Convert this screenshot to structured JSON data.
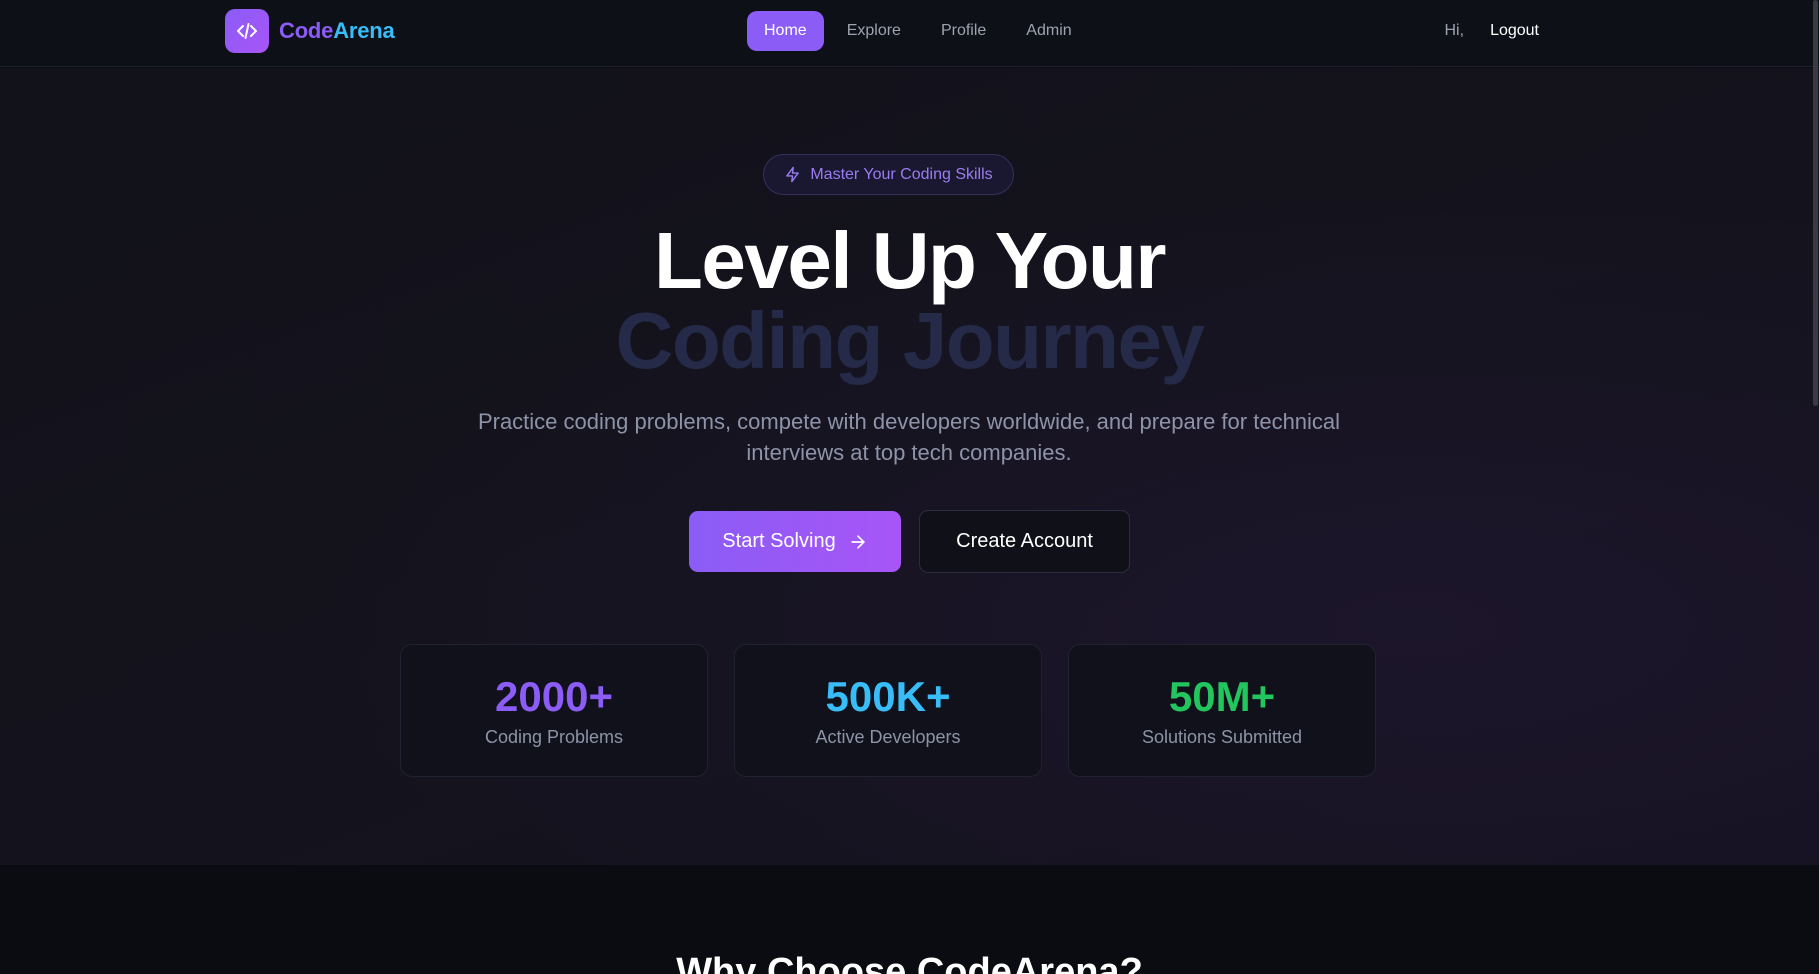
{
  "navbar": {
    "brand": {
      "part1": "Code",
      "part2": "Arena",
      "icon": "code-icon"
    },
    "links": [
      {
        "label": "Home",
        "active": true
      },
      {
        "label": "Explore",
        "active": false
      },
      {
        "label": "Profile",
        "active": false
      },
      {
        "label": "Admin",
        "active": false
      }
    ],
    "greeting": "Hi,",
    "logout_label": "Logout"
  },
  "hero": {
    "badge": {
      "icon": "lightning-icon",
      "label": "Master Your Coding Skills"
    },
    "headline_line1": "Level Up Your",
    "headline_line2": "Coding Journey",
    "subtitle": "Practice coding problems, compete with developers worldwide, and prepare for technical interviews at top tech companies.",
    "primary_cta": {
      "label": "Start Solving",
      "icon": "arrow-right-icon"
    },
    "secondary_cta": {
      "label": "Create Account"
    }
  },
  "stats": [
    {
      "value": "2000+",
      "label": "Coding Problems",
      "color": "#8b5cf6"
    },
    {
      "value": "500K+",
      "label": "Active Developers",
      "color": "#38bdf8"
    },
    {
      "value": "50M+",
      "label": "Solutions Submitted",
      "color": "#22c55e"
    }
  ],
  "why_section": {
    "title": "Why Choose CodeArena?"
  },
  "colors": {
    "accent": "#8b5cf6",
    "secondary_accent": "#38bdf8",
    "background": "#0c0d14"
  }
}
